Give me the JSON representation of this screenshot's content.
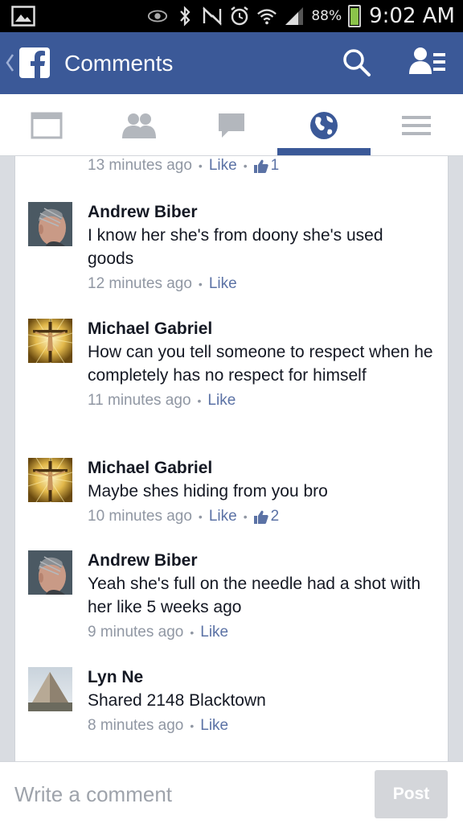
{
  "status_bar": {
    "battery_percent": "88%",
    "battery_level": 0.88,
    "time": "9:02 AM",
    "icons": [
      "gallery-notification-icon",
      "eye-icon",
      "bluetooth-icon",
      "nfc-icon",
      "alarm-icon",
      "wifi-icon",
      "signal-icon",
      "battery-icon"
    ]
  },
  "header": {
    "title": "Comments",
    "background": "#3b5998",
    "icons": [
      "back-chevron-icon",
      "facebook-logo-icon",
      "search-icon",
      "friend-requests-icon"
    ]
  },
  "tabs": [
    {
      "name": "news-feed",
      "icon": "news-feed-icon"
    },
    {
      "name": "friends",
      "icon": "friends-icon"
    },
    {
      "name": "messages",
      "icon": "messages-icon"
    },
    {
      "name": "notifications",
      "icon": "globe-icon",
      "active": true
    },
    {
      "name": "more",
      "icon": "menu-icon"
    }
  ],
  "top_comment_meta": {
    "time": "13 minutes ago",
    "like_label": "Like",
    "like_count": "1"
  },
  "comments": [
    {
      "author": "Andrew Biber",
      "text": "I know her she's from doony she's used goods",
      "time": "12 minutes ago",
      "like_label": "Like"
    },
    {
      "author": "Michael Gabriel",
      "text": "How can you tell someone to respect when he completely has no respect for himself",
      "time": "11 minutes ago",
      "like_label": "Like"
    },
    {
      "author": "Michael Gabriel",
      "text": "Maybe shes hiding from you bro",
      "time": "10 minutes ago",
      "like_label": "Like",
      "like_count": "2"
    },
    {
      "author": "Andrew Biber",
      "text": "Yeah she's full on the needle had a shot with her like 5 weeks ago",
      "time": "9 minutes ago",
      "like_label": "Like"
    },
    {
      "author": "Lyn Ne",
      "text": "Shared 2148 Blacktown",
      "time": "8 minutes ago",
      "like_label": "Like"
    }
  ],
  "composer": {
    "placeholder": "Write a comment",
    "value": "",
    "post_label": "Post"
  },
  "colors": {
    "brand": "#3b5998",
    "link": "#5b72a5",
    "meta": "#9097a3",
    "post_button_disabled": "#d4d6da"
  }
}
